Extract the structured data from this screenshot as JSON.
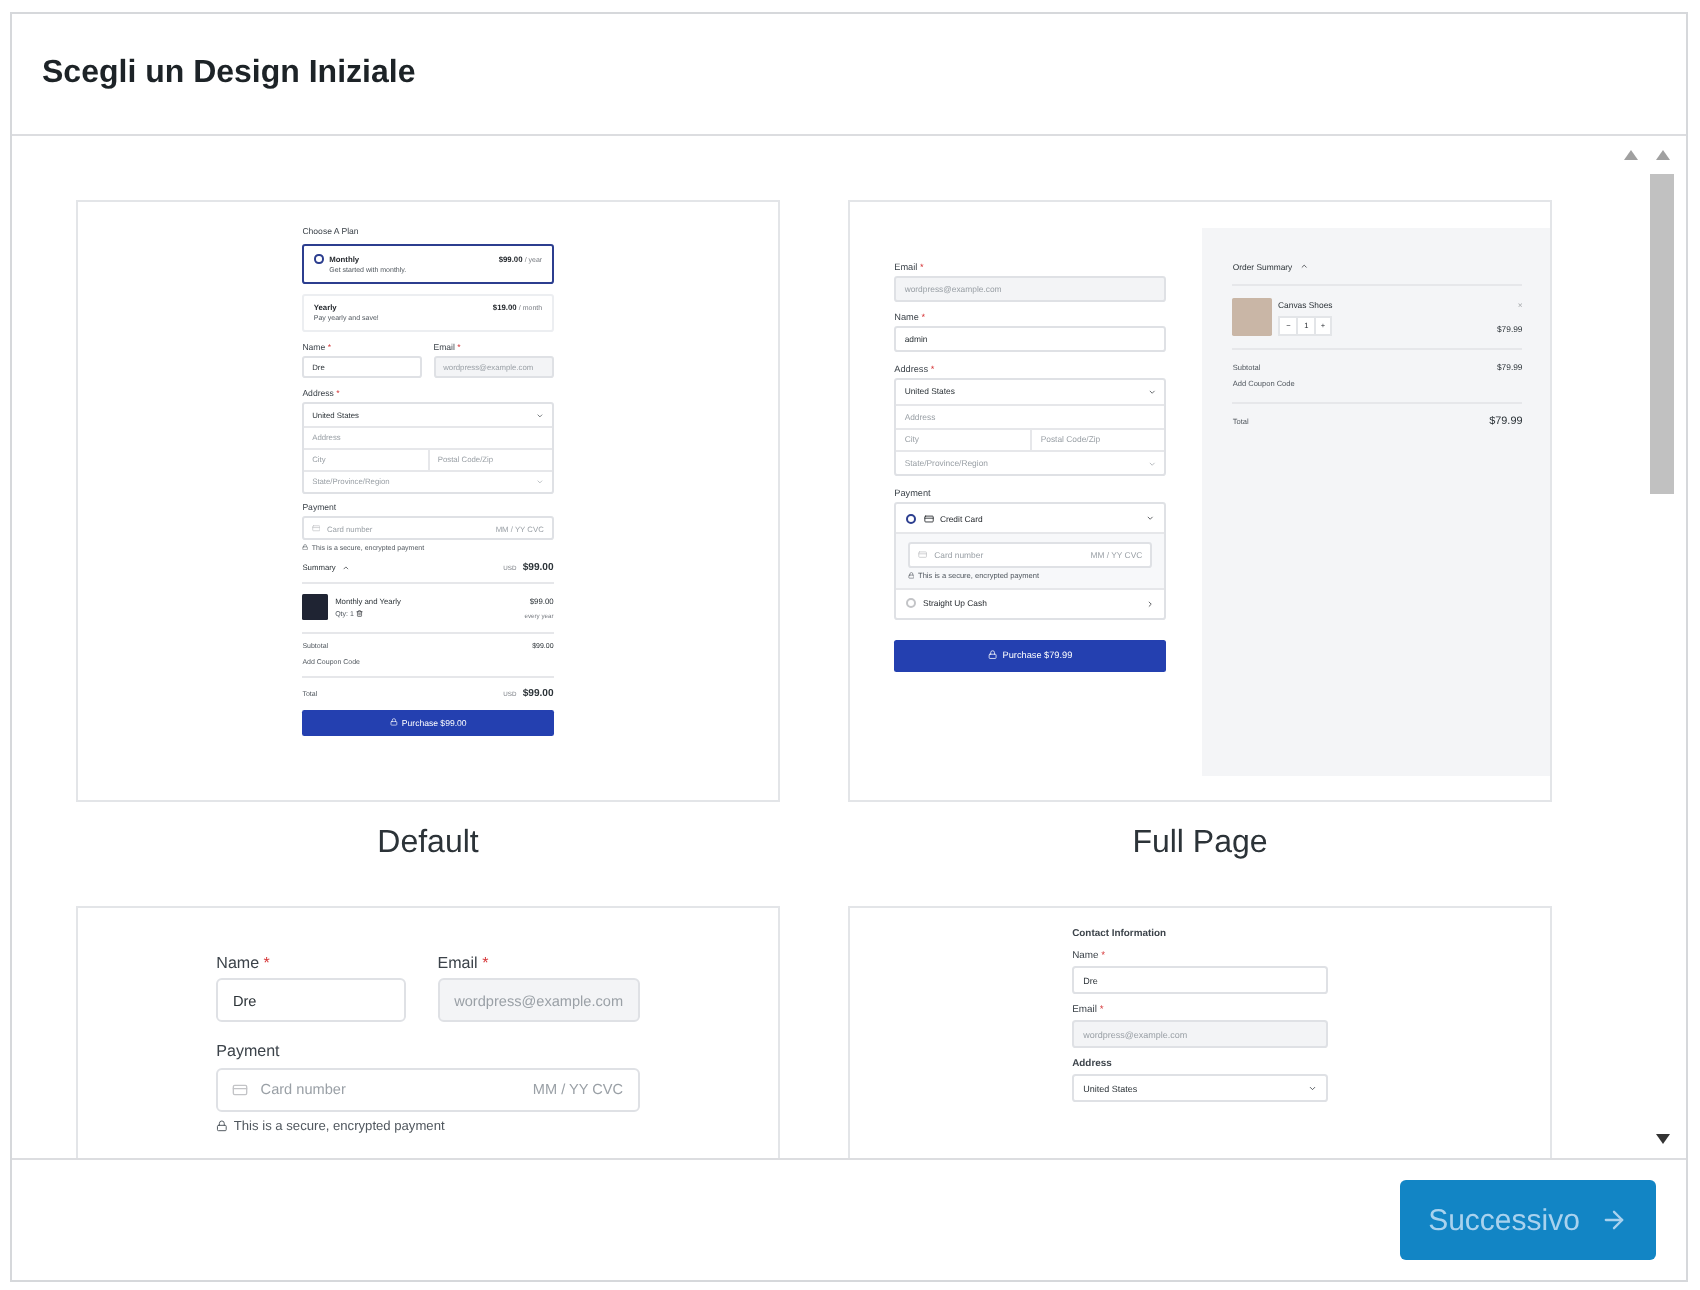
{
  "dialog": {
    "title": "Scegli un Design Iniziale"
  },
  "templates": [
    {
      "label": "Default",
      "preview": {
        "kind": "default",
        "plan_heading": "Choose A Plan",
        "plans": [
          {
            "name": "Monthly",
            "description": "Get started with monthly.",
            "price": "$99.00",
            "period": "/ year",
            "selected": true
          },
          {
            "name": "Yearly",
            "description": "Pay yearly and save!",
            "price": "$19.00",
            "period": "/ month",
            "selected": false
          }
        ],
        "fields": [
          {
            "label": "Name",
            "asterisk": "*",
            "value": "Dre",
            "disabled": false
          },
          {
            "label": "Email",
            "asterisk": "*",
            "value": "wordpress@example.com",
            "disabled": true
          }
        ],
        "address": {
          "label": "Address",
          "asterisk": "*",
          "country": "United States",
          "line": "Address",
          "city": "City",
          "postal": "Postal Code/Zip",
          "region": "State/Province/Region"
        },
        "payment": {
          "label": "Payment",
          "card_placeholder": "Card number",
          "expiry_placeholder": "MM / YY  CVC",
          "note": "This is a secure, encrypted payment"
        },
        "summary": {
          "heading": "Summary",
          "currency": "USD",
          "amount": "$99.00",
          "item": {
            "name": "Monthly and Yearly",
            "qty": "Qty: 1",
            "price": "$99.00",
            "period": "every year"
          },
          "subtotal_label": "Subtotal",
          "subtotal": "$99.00",
          "coupon": "Add Coupon Code",
          "total_label": "Total",
          "total_currency": "USD",
          "total": "$99.00"
        },
        "button": "Purchase $99.00"
      }
    },
    {
      "label": "Full Page",
      "preview": {
        "kind": "full_page",
        "fields": [
          {
            "label": "Email",
            "asterisk": "*",
            "value": "wordpress@example.com",
            "disabled": true
          },
          {
            "label": "Name",
            "asterisk": "*",
            "value": "admin",
            "disabled": false
          }
        ],
        "address": {
          "label": "Address",
          "asterisk": "*",
          "country": "United States",
          "line": "Address",
          "city": "City",
          "postal": "Postal Code/Zip",
          "region": "State/Province/Region"
        },
        "payment": {
          "label": "Payment",
          "methods": [
            {
              "label": "Credit Card",
              "selected": true
            },
            {
              "label": "Straight Up Cash",
              "selected": false
            }
          ],
          "card_placeholder": "Card number",
          "expiry_placeholder": "MM / YY  CVC",
          "note": "This is a secure, encrypted payment"
        },
        "button": "Purchase $79.99",
        "summary": {
          "heading": "Order Summary",
          "item": {
            "name": "Canvas Shoes",
            "minus": "−",
            "quantity": "1",
            "plus": "+",
            "remove": "×",
            "price": "$79.99"
          },
          "subtotal_label": "Subtotal",
          "subtotal": "$79.99",
          "coupon": "Add Coupon Code",
          "total_label": "Total",
          "total": "$79.99"
        }
      }
    },
    {
      "preview": {
        "kind": "simple",
        "fields": [
          {
            "label": "Name",
            "asterisk": "*",
            "value": "Dre",
            "disabled": false
          },
          {
            "label": "Email",
            "asterisk": "*",
            "value": "wordpress@example.com",
            "disabled": true
          }
        ],
        "payment": {
          "label": "Payment",
          "card_placeholder": "Card number",
          "expiry_placeholder": "MM / YY  CVC",
          "note": "This is a secure, encrypted payment"
        }
      }
    },
    {
      "preview": {
        "kind": "contact",
        "heading": "Contact Information",
        "fields": [
          {
            "label": "Name",
            "asterisk": "*",
            "value": "Dre",
            "disabled": false
          },
          {
            "label": "Email",
            "asterisk": "*",
            "value": "wordpress@example.com",
            "disabled": true
          }
        ],
        "address": {
          "label": "Address",
          "country": "United States"
        }
      }
    }
  ],
  "footer": {
    "next_button": "Successivo"
  }
}
